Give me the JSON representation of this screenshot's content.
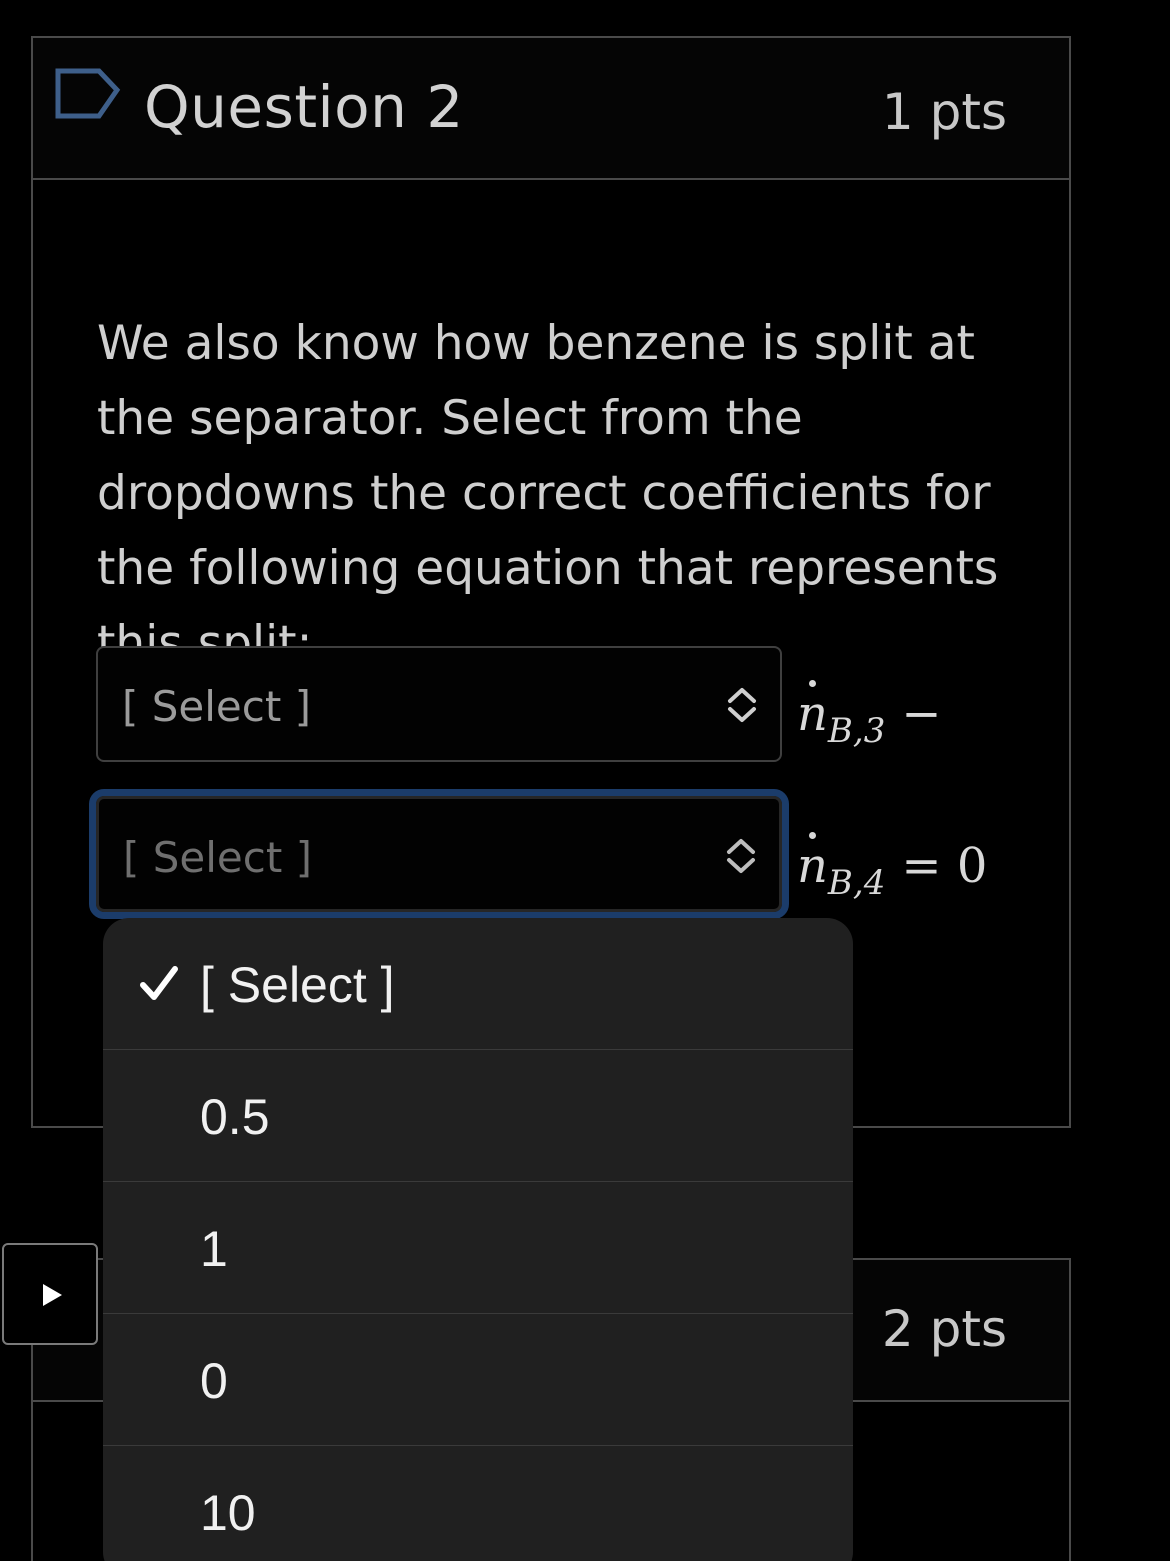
{
  "question1": {
    "title": "Question 2",
    "points": "1 pts",
    "text": "We also know how benzene is split at the separator. Select from the dropdowns the correct coefficients for the following equation that represents this split:",
    "select1_value": "[ Select ]",
    "select2_value": "[ Select ]",
    "equation_line1": {
      "var": "n",
      "sub": "B,3",
      "op": "−"
    },
    "equation_line2": {
      "var": "n",
      "sub": "B,4",
      "op": "= 0"
    }
  },
  "question2": {
    "points": "2 pts"
  },
  "dropdown": {
    "options": [
      "[ Select ]",
      "0.5",
      "1",
      "0",
      "10"
    ],
    "selected_index": 0
  },
  "icons": {
    "flag": "flag-outline-icon",
    "updown": "chevron-up-down-icon",
    "check": "checkmark-icon",
    "play": "play-icon"
  },
  "colors": {
    "background": "#000000",
    "focus_outline": "#1b3c6a",
    "dropdown_bg": "#202020"
  }
}
